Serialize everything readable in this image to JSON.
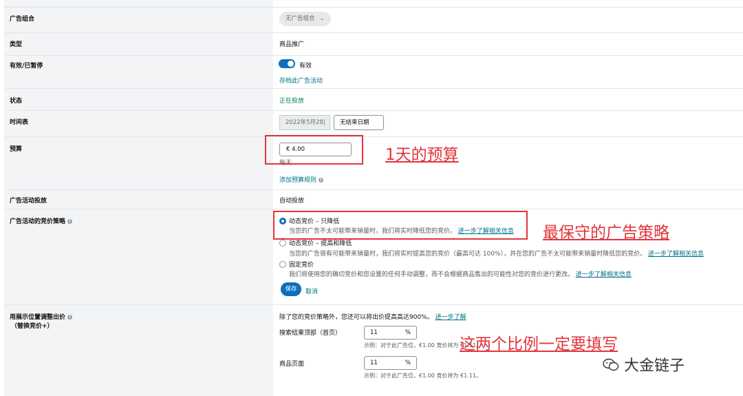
{
  "fields": {
    "ad_group_label": "广告组合",
    "ad_group_value": "无广告组合",
    "type_label": "类型",
    "type_value": "商品推广",
    "active_label": "有效/已暂停",
    "active_value": "有效",
    "archive_link": "存档此广告活动",
    "status_label": "状态",
    "status_value": "正在投放",
    "schedule_label": "时间表",
    "start_date": "2022年5月28|",
    "end_date": "无结束日期",
    "budget_label": "预算",
    "budget_value": "€  4.00",
    "budget_period": "每天",
    "budget_rule_link": "添加预算规则",
    "targeting_label": "广告活动投放",
    "targeting_value": "自动投放"
  },
  "bidding": {
    "label": "广告活动的竞价策略",
    "options": [
      {
        "title": "动态竞价 – 只降低",
        "desc": "当您的广告不太可能带来销量时，我们将实时降低您的竞价。",
        "link": "进一步了解相关信息",
        "selected": true
      },
      {
        "title": "动态竞价 – 提高和降低",
        "desc": "当您的广告很有可能带来销量时，我们将实时提高您的竞价（最高可达 100%），并在您的广告不太可能带来销量时降低您的竞价。",
        "link": "进一步了解相关信息",
        "selected": false
      },
      {
        "title": "固定竞价",
        "desc": "我们将使用您的确切竞价和您设置的任何手动调整，而不会根据商品售出的可能性对您的竞价进行更改。",
        "link": "进一步了解相关信息",
        "selected": false
      }
    ],
    "save": "保存",
    "cancel": "取消"
  },
  "placement": {
    "label": "用展示位置调整出价",
    "sublabel": "（替换竞价+）",
    "intro": "除了您的竞价策略外，您还可以将出价提高高达900%。",
    "intro_link": "进一步了解",
    "rows": [
      {
        "name": "搜索结果顶部（首页）",
        "value": "11",
        "unit": "%",
        "example": "示例：对于此广告位，€1.00 竞价将为 €1.11。"
      },
      {
        "name": "商品页面",
        "value": "11",
        "unit": "%",
        "example": "示例：对于此广告位，€1.00 竞价将为 €1.11。"
      }
    ]
  },
  "annotations": {
    "budget_note": "1天的预算",
    "strategy_note": "最保守的广告策略",
    "placement_note": "这两个比例一定要填写",
    "watermark": "大金链子"
  },
  "colors": {
    "accent": "#0a6fbd",
    "link": "#007185",
    "annotation": "#e3343a",
    "status": "#067d62"
  }
}
